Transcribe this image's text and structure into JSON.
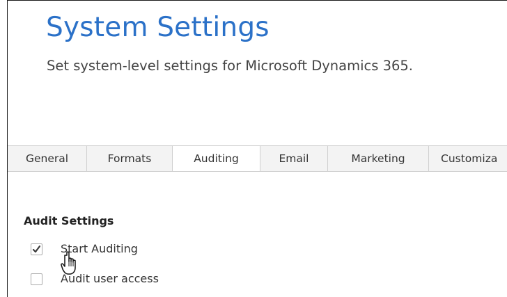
{
  "header": {
    "title": "System Settings",
    "subtitle": "Set system-level settings for Microsoft Dynamics 365."
  },
  "tabs": [
    {
      "label": "General"
    },
    {
      "label": "Formats"
    },
    {
      "label": "Auditing",
      "active": true
    },
    {
      "label": "Email"
    },
    {
      "label": "Marketing"
    },
    {
      "label": "Customiza"
    }
  ],
  "audit_section": {
    "title": "Audit Settings",
    "options": [
      {
        "label": "Start Auditing",
        "checked": true
      },
      {
        "label": "Audit user access",
        "checked": false
      }
    ]
  },
  "colors": {
    "title": "#2b71c8",
    "text": "#333333"
  },
  "cursor": "hand-pointer-icon"
}
